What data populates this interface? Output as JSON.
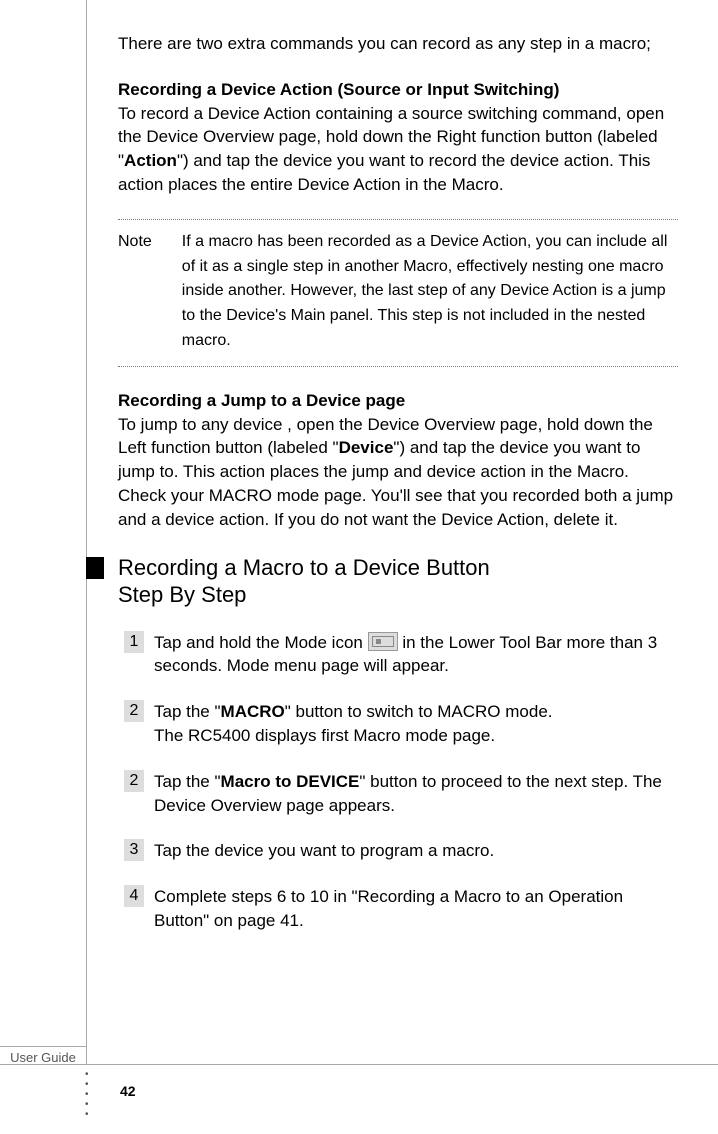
{
  "intro": "There are two extra commands you can record as any step in a macro;",
  "section1": {
    "heading": "Recording a Device Action (Source or Input Switching)",
    "body_pre": "To record a Device Action containing a source switching command, open the Device Overview page, hold down the Right function button (labeled \"",
    "bold1": "Action",
    "body_post": "\") and tap the device you want to record the device action. This action places the entire Device Action in the Macro."
  },
  "note": {
    "label": "Note",
    "body": "If a macro has been recorded as a Device Action, you can include all of it as a single step in another Macro, effectively nesting one macro inside another. However, the last step of any Device Action is a jump to the Device's Main panel. This step is not included in the nested macro."
  },
  "section2": {
    "heading": "Recording a Jump to a Device page",
    "body_pre": "To jump to any device , open the Device Overview page, hold down the Left function button (labeled \"",
    "bold1": "Device",
    "body_post": "\") and tap the device you want to jump to. This action places the jump and device action in the Macro. Check your MACRO mode page. You'll see that you recorded both a jump and a device action. If you do not want the Device Action, delete it."
  },
  "big_heading": {
    "line1": "Recording a Macro to a Device Button",
    "line2": "Step By Step"
  },
  "steps": [
    {
      "num": "1",
      "pre": "Tap and hold the Mode icon ",
      "icon": true,
      "post": " in the Lower Tool Bar more than 3 seconds. Mode menu page will appear."
    },
    {
      "num": "2",
      "pre": "Tap the \"",
      "bold": "MACRO",
      "post": "\" button to switch to MACRO mode.\nThe RC5400 displays first Macro mode page."
    },
    {
      "num": "2",
      "pre": "Tap the \"",
      "bold": "Macro to DEVICE",
      "post": "\" button to proceed to the next step. The Device Overview page appears."
    },
    {
      "num": "3",
      "pre": "Tap the device you want to program a macro."
    },
    {
      "num": "4",
      "pre": "Complete steps 6 to 10 in \"Recording a Macro to an Operation Button\" on page 41."
    }
  ],
  "footer_tab": "User Guide",
  "page_number": "42"
}
